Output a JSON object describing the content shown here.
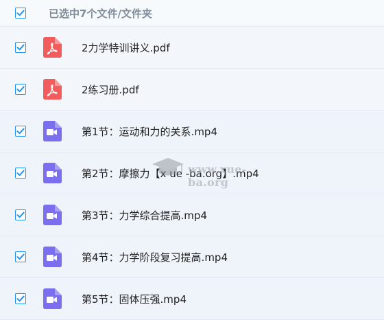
{
  "header": {
    "selection_text": "已选中7个文件/文件夹",
    "checked": true
  },
  "files": [
    {
      "name": "2力学特训讲义.pdf",
      "type": "pdf",
      "checked": true
    },
    {
      "name": "2练习册.pdf",
      "type": "pdf",
      "checked": true
    },
    {
      "name": "第1节：运动和力的关系.mp4",
      "type": "video",
      "checked": true
    },
    {
      "name": "第2节：摩擦力【x ue -ba.org】.mp4",
      "type": "video",
      "checked": true
    },
    {
      "name": "第3节：力学综合提高.mp4",
      "type": "video",
      "checked": true
    },
    {
      "name": "第4节：力学阶段复习提高.mp4",
      "type": "video",
      "checked": true
    },
    {
      "name": "第5节：固体压强.mp4",
      "type": "video",
      "checked": true
    }
  ],
  "watermark": {
    "text": "www.xue-ba.org"
  },
  "colors": {
    "checkbox": "#1e93f5",
    "pdf_icon": "#f25c5c",
    "video_icon": "#7b6ff0"
  }
}
